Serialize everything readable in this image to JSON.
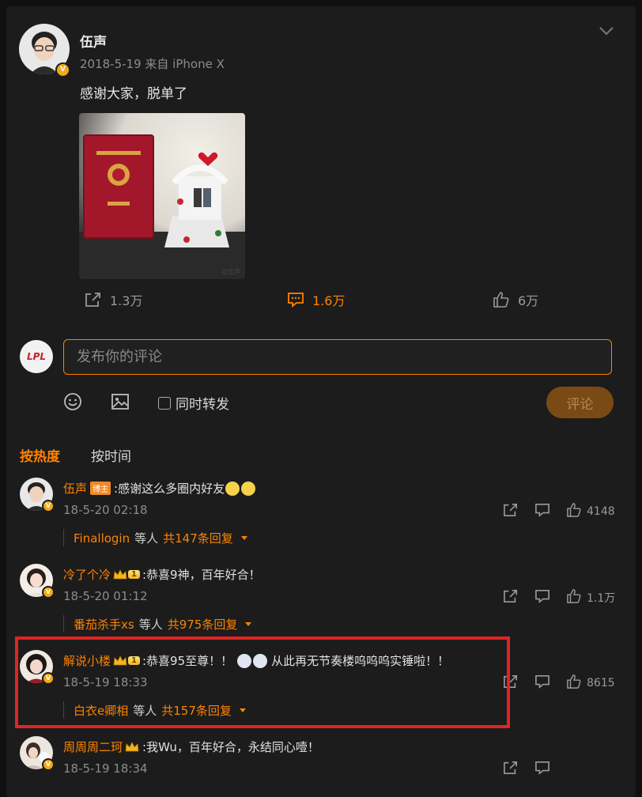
{
  "post": {
    "author": "伍声",
    "meta": "2018-5-19 来自 iPhone X",
    "text": "感谢大家，脱单了",
    "photo_watermark": "@伍声",
    "actions": {
      "share": "1.3万",
      "comment": "1.6万",
      "like": "6万"
    }
  },
  "composer": {
    "placeholder": "发布你的评论",
    "repost_label": "同时转发",
    "submit_label": "评论",
    "avatar_text": "LPL"
  },
  "tabs": {
    "hot": "按热度",
    "time": "按时间"
  },
  "comments": [
    {
      "name": "伍声",
      "badge": "博主",
      "text": ":感谢这么多圈内好友",
      "time": "18-5-20 02:18",
      "likes": "4148",
      "reply_name": "Finallogin",
      "reply_mid": "等人",
      "reply_count": "共147条回复"
    },
    {
      "name": "冷了个冷",
      "level": "1",
      "text": ":恭喜9神，百年好合！",
      "time": "18-5-20 01:12",
      "likes": "1.1万",
      "reply_name": "番茄杀手xs",
      "reply_mid": "等人",
      "reply_count": "共975条回复"
    },
    {
      "name": "解说小楼",
      "level": "1",
      "text": ":恭喜95至尊！！",
      "text2": "从此再无节奏楼呜呜呜实锤啦！！",
      "time": "18-5-19 18:33",
      "likes": "8615",
      "reply_name": "白衣e卿相",
      "reply_mid": "等人",
      "reply_count": "共157条回复"
    },
    {
      "name": "周周周二珂",
      "text": ":我Wu，百年好合，永结同心噎！",
      "time": "18-5-19 18:34"
    }
  ],
  "colors": {
    "accent": "#ff8200",
    "highlight": "#e02424",
    "background": "#1c1c1c"
  }
}
